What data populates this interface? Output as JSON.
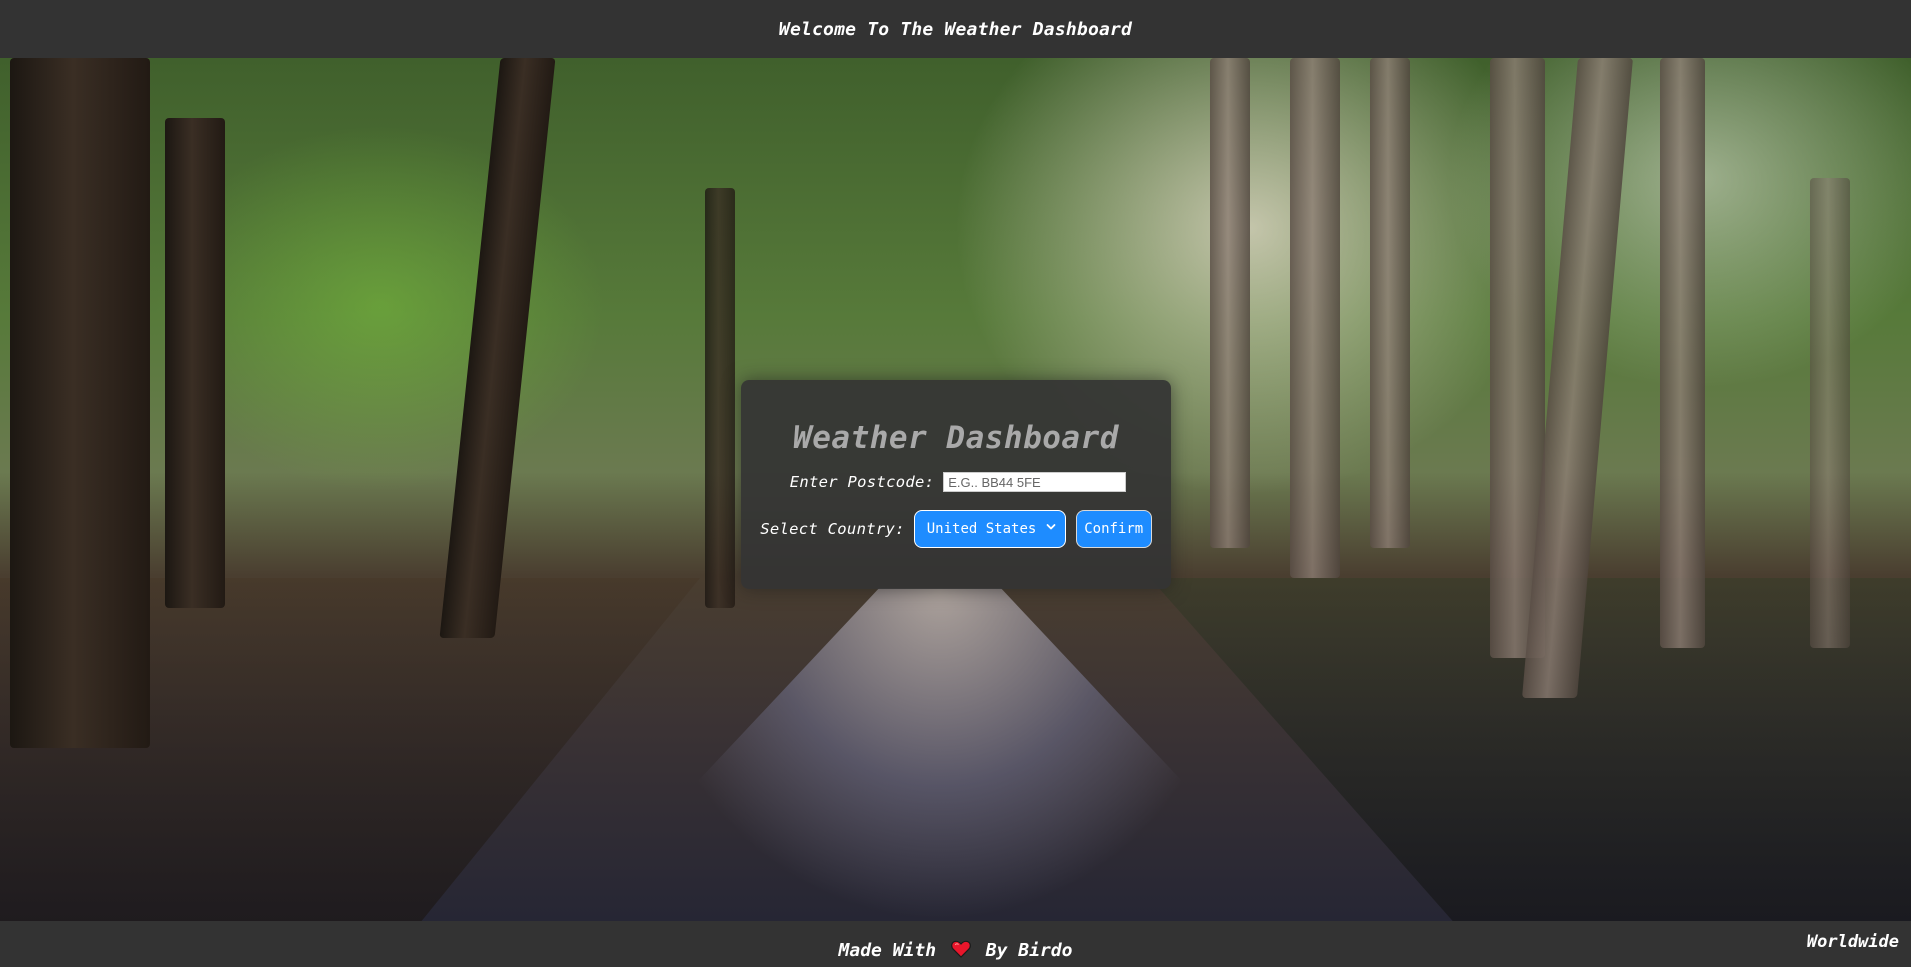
{
  "header": {
    "title": "Welcome To The Weather Dashboard"
  },
  "card": {
    "title": "Weather Dashboard",
    "postcode": {
      "label": "Enter Postcode:",
      "value": "",
      "placeholder": "E.G.. BB44 5FE"
    },
    "country": {
      "label": "Select Country:",
      "selected": "United States"
    },
    "confirm_label": "Confirm"
  },
  "footer": {
    "credit_prefix": "Made With",
    "credit_icon": "heart-icon",
    "credit_suffix": "By Birdo",
    "region": "Worldwide"
  },
  "colors": {
    "bar_background": "#333333",
    "card_background": "#343434",
    "accent_blue": "#1e8cff",
    "title_gray": "#a9a9a9",
    "heart_red": "#e8162b"
  }
}
